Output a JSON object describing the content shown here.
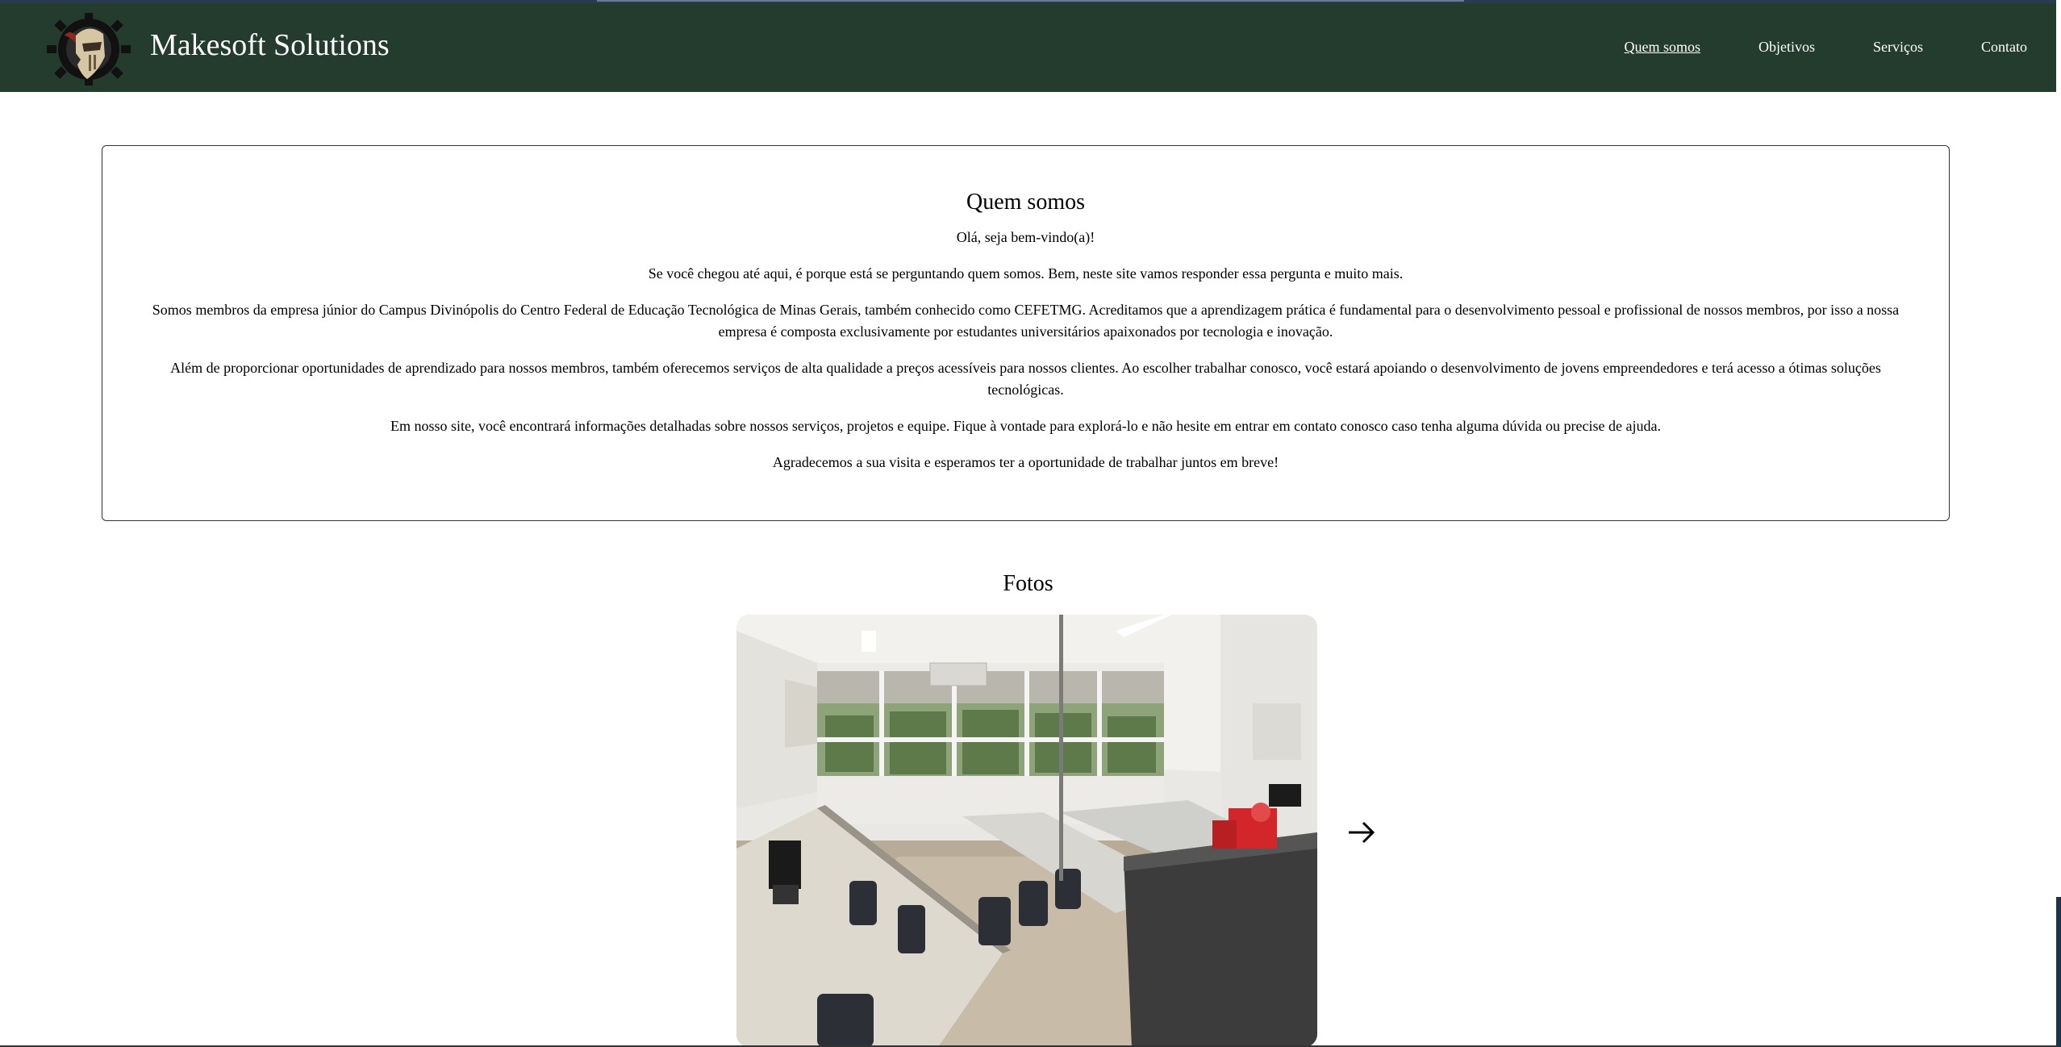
{
  "header": {
    "brand": "Makesoft Solutions",
    "logo_icon": "knight-helmet-gear-logo",
    "nav": [
      {
        "label": "Quem somos",
        "active": true
      },
      {
        "label": "Objetivos",
        "active": false
      },
      {
        "label": "Serviços",
        "active": false
      },
      {
        "label": "Contato",
        "active": false
      }
    ]
  },
  "about": {
    "title": "Quem somos",
    "paragraphs": [
      "Olá, seja bem-vindo(a)!",
      "Se você chegou até aqui, é porque está se perguntando quem somos. Bem, neste site vamos responder essa pergunta e muito mais.",
      "Somos membros da empresa júnior do Campus Divinópolis do Centro Federal de Educação Tecnológica de Minas Gerais, também conhecido como CEFETMG. Acreditamos que a aprendizagem prática é fundamental para o desenvolvimento pessoal e profissional de nossos membros, por isso a nossa empresa é composta exclusivamente por estudantes universitários apaixonados por tecnologia e inovação.",
      "Além de proporcionar oportunidades de aprendizado para nossos membros, também oferecemos serviços de alta qualidade a preços acessíveis para nossos clientes. Ao escolher trabalhar conosco, você estará apoiando o desenvolvimento de jovens empreendedores e terá acesso a ótimas soluções tecnológicas.",
      "Em nosso site, você encontrará informações detalhadas sobre nossos serviços, projetos e equipe. Fique à vontade para explorá-lo e não hesite em entrar em contato conosco caso tenha alguma dúvida ou precise de ajuda.",
      "Agradecemos a sua visita e esperamos ter a oportunidade de trabalhar juntos em breve!"
    ]
  },
  "fotos": {
    "title": "Fotos",
    "next_icon": "arrow-right-icon"
  },
  "colors": {
    "header_bg": "#233c2d",
    "header_text": "#ffffff",
    "page_bg": "#ffffff"
  }
}
